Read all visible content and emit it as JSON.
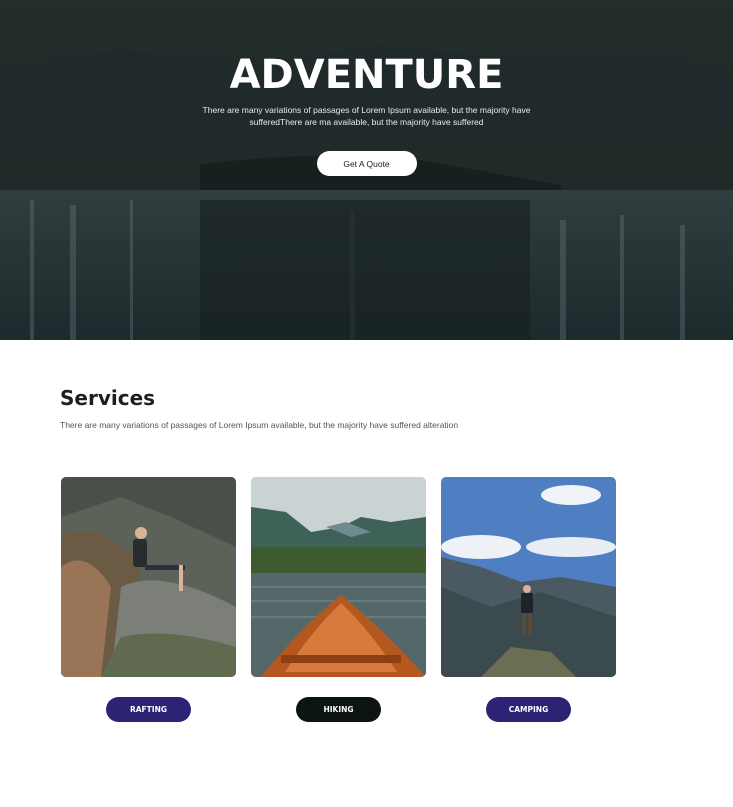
{
  "hero": {
    "title": "ADVENTURE",
    "subtitle": "There are many variations of passages of Lorem Ipsum available, but the majority have sufferedThere are ma available, but the majority have suffered",
    "cta_label": "Get A Quote"
  },
  "services": {
    "title": "Services",
    "description": "There are many variations of passages of Lorem Ipsum available, but the majority have suffered alteration",
    "items": [
      {
        "label": "RAFTING",
        "color": "#2d2375"
      },
      {
        "label": "HIKING",
        "color": "#0b1313"
      },
      {
        "label": "CAMPING",
        "color": "#2d2375"
      }
    ]
  },
  "colors": {
    "accent": "#2d2375",
    "dark": "#0b1313",
    "hero_overlay": "#1d2625"
  }
}
